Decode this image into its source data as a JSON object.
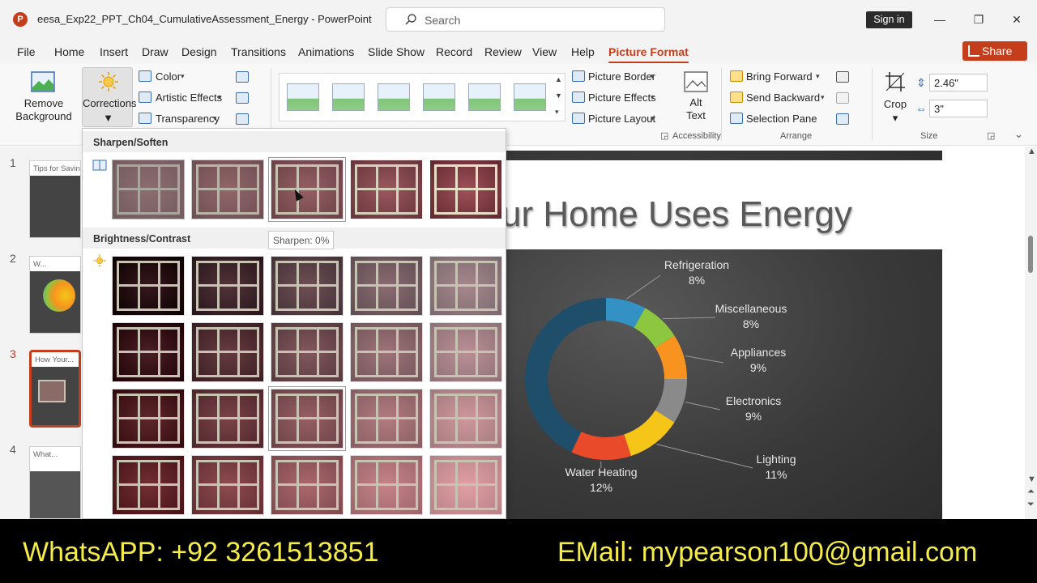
{
  "app": {
    "doc_title": "eesa_Exp22_PPT_Ch04_CumulativeAssessment_Energy  -  PowerPoint",
    "logo_letter": "P",
    "search_placeholder": "Search",
    "signin_label": "Sign in",
    "minimize": "—",
    "maximize": "❐",
    "close": "✕"
  },
  "tabs": [
    "File",
    "Home",
    "Insert",
    "Draw",
    "Design",
    "Transitions",
    "Animations",
    "Slide Show",
    "Record",
    "Review",
    "View",
    "Help",
    "Picture Format"
  ],
  "active_tab": "Picture Format",
  "share_label": "Share",
  "ribbon": {
    "remove_background": [
      "Remove",
      "Background"
    ],
    "corrections": "Corrections",
    "color": "Color",
    "artistic_effects": "Artistic Effects",
    "transparency": "Transparency",
    "picture_border": "Picture Border",
    "picture_effects": "Picture Effects",
    "picture_layout": "Picture Layout",
    "alt_text": [
      "Alt",
      "Text"
    ],
    "accessibility_group": "Accessibility",
    "bring_forward": "Bring Forward",
    "send_backward": "Send Backward",
    "selection_pane": "Selection Pane",
    "arrange_group": "Arrange",
    "crop": "Crop",
    "height": "2.46\"",
    "width": "3\"",
    "size_group": "Size"
  },
  "dropdown": {
    "sharpen_header": "Sharpen/Soften",
    "brightness_header": "Brightness/Contrast",
    "tooltip": "Sharpen: 0%",
    "sharpen_levels": [
      -50,
      -25,
      0,
      25,
      50
    ],
    "brightness_levels": [
      -40,
      -20,
      0,
      20,
      40
    ],
    "contrast_levels": [
      -40,
      -20,
      0,
      20
    ]
  },
  "slides": [
    {
      "num": "1",
      "title": "Tips for Savin... Your H..."
    },
    {
      "num": "2",
      "title": "W..."
    },
    {
      "num": "3",
      "title": "How Your..."
    },
    {
      "num": "4",
      "title": "What..."
    }
  ],
  "slide": {
    "title": "ur Home Uses Energy"
  },
  "chart_data": {
    "type": "pie",
    "categories": [
      "Refrigeration",
      "Miscellaneous",
      "Appliances",
      "Electronics",
      "Lighting",
      "Water Heating"
    ],
    "values": [
      8,
      8,
      9,
      9,
      11,
      12
    ],
    "labels": [
      "8%",
      "8%",
      "9%",
      "9%",
      "11%",
      "12%"
    ],
    "colors": [
      "#3391c4",
      "#8dc63f",
      "#f7931e",
      "#8a8a8a",
      "#f5c518",
      "#e84a2a"
    ]
  },
  "chart_rest_color": "#1f4e6b",
  "banner": {
    "whatsapp": "WhatsAPP: +92 3261513851",
    "email": "EMail: mypearson100@gmail.com"
  }
}
